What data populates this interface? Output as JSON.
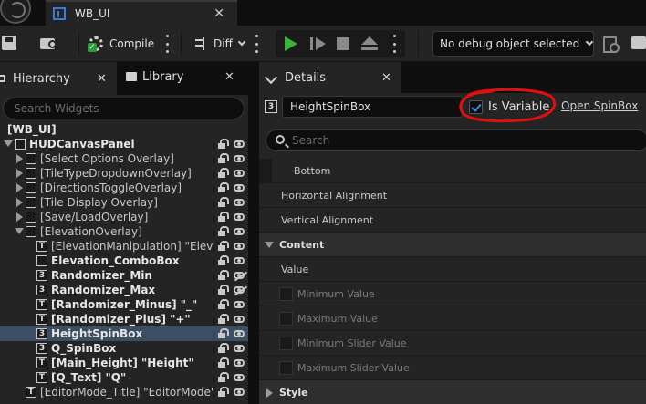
{
  "document_tab": {
    "title": "WB_UI",
    "close": "✕"
  },
  "toolbar": {
    "compile_label": "Compile",
    "diff_label": "Diff",
    "debug_object": "No debug object selected"
  },
  "left_panel": {
    "tabs": [
      {
        "label": "Hierarchy",
        "close": "✕"
      },
      {
        "label": "Library",
        "close": "✕"
      }
    ],
    "search_placeholder": "Search Widgets",
    "tree": [
      {
        "label": "[WB_UI]",
        "bold": true,
        "icon": "",
        "expander": ""
      },
      {
        "label": "HUDCanvasPanel",
        "bold": true,
        "icon": "canvas",
        "expander": "open"
      },
      {
        "label": "[Select Options Overlay]",
        "bold": false,
        "icon": "overlay",
        "expander": "closed"
      },
      {
        "label": "[TileTypeDropdownOverlay]",
        "bold": false,
        "icon": "overlay",
        "expander": "closed"
      },
      {
        "label": "[DirectionsToggleOverlay]",
        "bold": false,
        "icon": "overlay",
        "expander": "closed"
      },
      {
        "label": "[Tile Display Overlay]",
        "bold": false,
        "icon": "overlay",
        "expander": "closed"
      },
      {
        "label": "[Save/LoadOverlay]",
        "bold": false,
        "icon": "overlay",
        "expander": "closed"
      },
      {
        "label": "[ElevationOverlay]",
        "bold": false,
        "icon": "overlay",
        "expander": "open"
      },
      {
        "label": "[ElevationManipulation] \"Elevation",
        "bold": false,
        "icon": "T",
        "expander": ""
      },
      {
        "label": "Elevation_ComboBox",
        "bold": true,
        "icon": "combo",
        "expander": ""
      },
      {
        "label": "Randomizer_Min",
        "bold": true,
        "icon": "3",
        "expander": ""
      },
      {
        "label": "Randomizer_Max",
        "bold": true,
        "icon": "3",
        "expander": ""
      },
      {
        "label": "[Randomizer_Minus] \"_\"",
        "bold": true,
        "icon": "T",
        "expander": ""
      },
      {
        "label": "[Randomizer_Plus] \"+\"",
        "bold": true,
        "icon": "T",
        "expander": ""
      },
      {
        "label": "HeightSpinBox",
        "bold": true,
        "icon": "3",
        "expander": "",
        "selected": true
      },
      {
        "label": "Q_SpinBox",
        "bold": true,
        "icon": "3",
        "expander": ""
      },
      {
        "label": "[Main_Height] \"Height\"",
        "bold": true,
        "icon": "T",
        "expander": ""
      },
      {
        "label": "[Q_Text] \"Q\"",
        "bold": true,
        "icon": "T",
        "expander": ""
      },
      {
        "label": "[EditorMode_Title] \"EditorMode\"",
        "bold": false,
        "icon": "T",
        "expander": ""
      }
    ]
  },
  "details_panel": {
    "tab": {
      "label": "Details",
      "close": "✕"
    },
    "widget_name": "HeightSpinBox",
    "is_variable_label": "Is Variable",
    "is_variable_checked": true,
    "open_link": "Open SpinBox",
    "search_placeholder": "Search",
    "rows": [
      {
        "label": "Bottom",
        "kind": "sub"
      },
      {
        "label": "Horizontal Alignment",
        "kind": "plain"
      },
      {
        "label": "Vertical Alignment",
        "kind": "plain"
      },
      {
        "label": "Content",
        "kind": "header"
      },
      {
        "label": "Value",
        "kind": "plain"
      },
      {
        "label": "Minimum Value",
        "kind": "check"
      },
      {
        "label": "Maximum Value",
        "kind": "check"
      },
      {
        "label": "Minimum Slider Value",
        "kind": "check"
      },
      {
        "label": "Maximum Slider Value",
        "kind": "check"
      },
      {
        "label": "Style",
        "kind": "header-closed"
      }
    ]
  },
  "colors": {
    "accent_green": "#3ab33a",
    "selection": "#3b4e63",
    "highlight_ring": "#e01010",
    "checkbox_check": "#3b8ee8"
  }
}
